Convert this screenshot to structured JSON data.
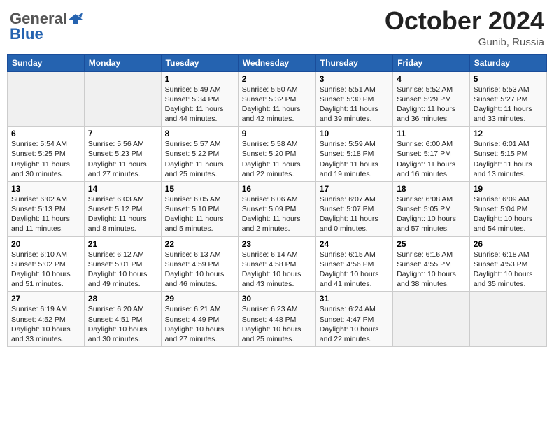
{
  "header": {
    "logo_general": "General",
    "logo_blue": "Blue",
    "month": "October 2024",
    "location": "Gunib, Russia"
  },
  "days_of_week": [
    "Sunday",
    "Monday",
    "Tuesday",
    "Wednesday",
    "Thursday",
    "Friday",
    "Saturday"
  ],
  "weeks": [
    [
      {
        "num": "",
        "detail": ""
      },
      {
        "num": "",
        "detail": ""
      },
      {
        "num": "1",
        "detail": "Sunrise: 5:49 AM\nSunset: 5:34 PM\nDaylight: 11 hours and 44 minutes."
      },
      {
        "num": "2",
        "detail": "Sunrise: 5:50 AM\nSunset: 5:32 PM\nDaylight: 11 hours and 42 minutes."
      },
      {
        "num": "3",
        "detail": "Sunrise: 5:51 AM\nSunset: 5:30 PM\nDaylight: 11 hours and 39 minutes."
      },
      {
        "num": "4",
        "detail": "Sunrise: 5:52 AM\nSunset: 5:29 PM\nDaylight: 11 hours and 36 minutes."
      },
      {
        "num": "5",
        "detail": "Sunrise: 5:53 AM\nSunset: 5:27 PM\nDaylight: 11 hours and 33 minutes."
      }
    ],
    [
      {
        "num": "6",
        "detail": "Sunrise: 5:54 AM\nSunset: 5:25 PM\nDaylight: 11 hours and 30 minutes."
      },
      {
        "num": "7",
        "detail": "Sunrise: 5:56 AM\nSunset: 5:23 PM\nDaylight: 11 hours and 27 minutes."
      },
      {
        "num": "8",
        "detail": "Sunrise: 5:57 AM\nSunset: 5:22 PM\nDaylight: 11 hours and 25 minutes."
      },
      {
        "num": "9",
        "detail": "Sunrise: 5:58 AM\nSunset: 5:20 PM\nDaylight: 11 hours and 22 minutes."
      },
      {
        "num": "10",
        "detail": "Sunrise: 5:59 AM\nSunset: 5:18 PM\nDaylight: 11 hours and 19 minutes."
      },
      {
        "num": "11",
        "detail": "Sunrise: 6:00 AM\nSunset: 5:17 PM\nDaylight: 11 hours and 16 minutes."
      },
      {
        "num": "12",
        "detail": "Sunrise: 6:01 AM\nSunset: 5:15 PM\nDaylight: 11 hours and 13 minutes."
      }
    ],
    [
      {
        "num": "13",
        "detail": "Sunrise: 6:02 AM\nSunset: 5:13 PM\nDaylight: 11 hours and 11 minutes."
      },
      {
        "num": "14",
        "detail": "Sunrise: 6:03 AM\nSunset: 5:12 PM\nDaylight: 11 hours and 8 minutes."
      },
      {
        "num": "15",
        "detail": "Sunrise: 6:05 AM\nSunset: 5:10 PM\nDaylight: 11 hours and 5 minutes."
      },
      {
        "num": "16",
        "detail": "Sunrise: 6:06 AM\nSunset: 5:09 PM\nDaylight: 11 hours and 2 minutes."
      },
      {
        "num": "17",
        "detail": "Sunrise: 6:07 AM\nSunset: 5:07 PM\nDaylight: 11 hours and 0 minutes."
      },
      {
        "num": "18",
        "detail": "Sunrise: 6:08 AM\nSunset: 5:05 PM\nDaylight: 10 hours and 57 minutes."
      },
      {
        "num": "19",
        "detail": "Sunrise: 6:09 AM\nSunset: 5:04 PM\nDaylight: 10 hours and 54 minutes."
      }
    ],
    [
      {
        "num": "20",
        "detail": "Sunrise: 6:10 AM\nSunset: 5:02 PM\nDaylight: 10 hours and 51 minutes."
      },
      {
        "num": "21",
        "detail": "Sunrise: 6:12 AM\nSunset: 5:01 PM\nDaylight: 10 hours and 49 minutes."
      },
      {
        "num": "22",
        "detail": "Sunrise: 6:13 AM\nSunset: 4:59 PM\nDaylight: 10 hours and 46 minutes."
      },
      {
        "num": "23",
        "detail": "Sunrise: 6:14 AM\nSunset: 4:58 PM\nDaylight: 10 hours and 43 minutes."
      },
      {
        "num": "24",
        "detail": "Sunrise: 6:15 AM\nSunset: 4:56 PM\nDaylight: 10 hours and 41 minutes."
      },
      {
        "num": "25",
        "detail": "Sunrise: 6:16 AM\nSunset: 4:55 PM\nDaylight: 10 hours and 38 minutes."
      },
      {
        "num": "26",
        "detail": "Sunrise: 6:18 AM\nSunset: 4:53 PM\nDaylight: 10 hours and 35 minutes."
      }
    ],
    [
      {
        "num": "27",
        "detail": "Sunrise: 6:19 AM\nSunset: 4:52 PM\nDaylight: 10 hours and 33 minutes."
      },
      {
        "num": "28",
        "detail": "Sunrise: 6:20 AM\nSunset: 4:51 PM\nDaylight: 10 hours and 30 minutes."
      },
      {
        "num": "29",
        "detail": "Sunrise: 6:21 AM\nSunset: 4:49 PM\nDaylight: 10 hours and 27 minutes."
      },
      {
        "num": "30",
        "detail": "Sunrise: 6:23 AM\nSunset: 4:48 PM\nDaylight: 10 hours and 25 minutes."
      },
      {
        "num": "31",
        "detail": "Sunrise: 6:24 AM\nSunset: 4:47 PM\nDaylight: 10 hours and 22 minutes."
      },
      {
        "num": "",
        "detail": ""
      },
      {
        "num": "",
        "detail": ""
      }
    ]
  ]
}
